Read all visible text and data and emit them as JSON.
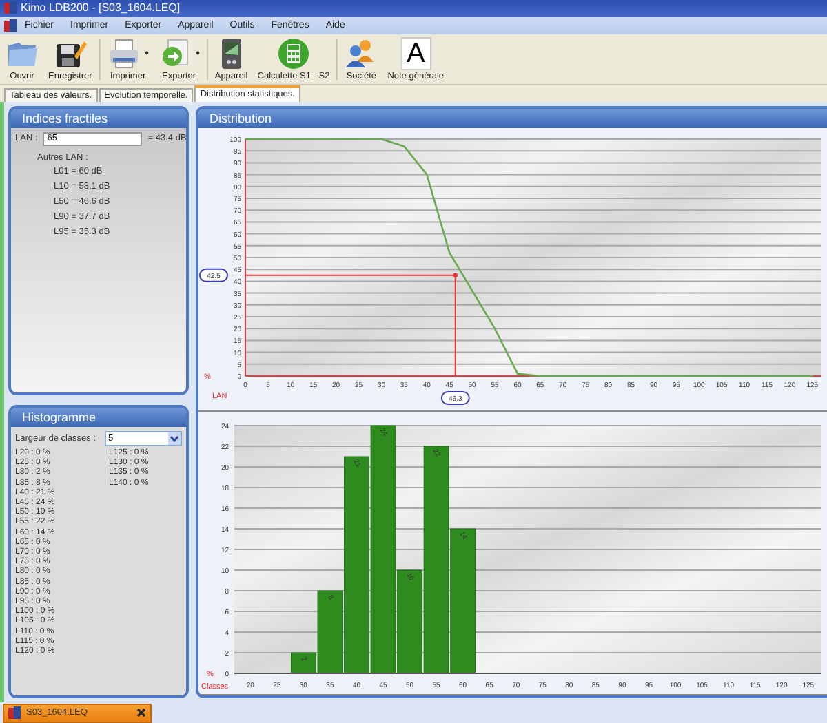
{
  "window": {
    "title": "Kimo LDB200 - [S03_1604.LEQ]"
  },
  "menu": [
    "Fichier",
    "Imprimer",
    "Exporter",
    "Appareil",
    "Outils",
    "Fenêtres",
    "Aide"
  ],
  "toolbar": [
    {
      "label": "Ouvrir",
      "dropdown": false
    },
    {
      "label": "Enregistrer",
      "dropdown": false
    },
    {
      "label": "Imprimer",
      "dropdown": true
    },
    {
      "label": "Exporter",
      "dropdown": true
    },
    {
      "label": "Appareil",
      "dropdown": false
    },
    {
      "label": "Calculette S1 - S2",
      "dropdown": false
    },
    {
      "label": "Société",
      "dropdown": false
    },
    {
      "label": "Note générale",
      "glyph": "A",
      "dropdown": false
    }
  ],
  "tabs": [
    {
      "label": "Tableau des valeurs.",
      "selected": false
    },
    {
      "label": "Evolution temporelle.",
      "selected": false
    },
    {
      "label": "Distribution statistiques.",
      "selected": true
    }
  ],
  "indices": {
    "title": "Indices fractiles",
    "lan_label": "LAN :",
    "lan_value": "65",
    "lan_result": "= 43.4 dB",
    "others_label": "Autres LAN :",
    "others": [
      "L01 = 60 dB",
      "L10 = 58.1 dB",
      "L50 = 46.6 dB",
      "L90 = 37.7 dB",
      "L95 = 35.3 dB"
    ]
  },
  "histogram_panel": {
    "title": "Histogramme",
    "width_label": "Largeur de classes :",
    "width_value": "5",
    "columns": [
      [
        "L20 : 0 %",
        "L25 : 0 %",
        "L30 : 2 %",
        "L35 : 8 %",
        "L40 : 21 %",
        "L45 : 24 %",
        "L50 : 10 %",
        "L55 : 22 %",
        "L60 : 14 %",
        "L65 : 0 %",
        "L70 : 0 %",
        "L75 : 0 %",
        "L80 : 0 %",
        "L85 : 0 %",
        "L90 : 0 %",
        "L95 : 0 %",
        "L100 : 0 %",
        "L105 : 0 %",
        "L110 : 0 %",
        "L115 : 0 %",
        "L120 : 0 %"
      ],
      [
        "L125 : 0 %",
        "L130 : 0 %",
        "L135 : 0 %",
        "L140 : 0 %"
      ]
    ]
  },
  "distribution": {
    "title": "Distribution",
    "cumulative": {
      "chart_data": {
        "type": "line",
        "xlabel": "LAN",
        "ylabel": "%",
        "x": [
          0,
          5,
          10,
          15,
          20,
          25,
          30,
          35,
          40,
          45,
          50,
          55,
          60,
          65,
          70,
          75,
          80,
          85,
          90,
          95,
          100,
          105,
          110,
          115,
          120,
          125
        ],
        "series": [
          {
            "color": "#6aa84f",
            "values": [
              100,
              100,
              100,
              100,
              100,
              100,
              100,
              97,
              85,
              52,
              36,
              20,
              1,
              0,
              0,
              0,
              0,
              0,
              0,
              0,
              0,
              0,
              0,
              0,
              0,
              0
            ]
          }
        ],
        "xlim": [
          0,
          127
        ],
        "ylim": [
          0,
          100
        ],
        "grid": true,
        "xticks": [
          0,
          5,
          10,
          15,
          20,
          25,
          30,
          35,
          40,
          45,
          50,
          55,
          60,
          65,
          70,
          75,
          80,
          85,
          90,
          95,
          100,
          105,
          110,
          115,
          120,
          125
        ],
        "yticks": [
          0,
          5,
          10,
          15,
          20,
          25,
          30,
          35,
          40,
          45,
          50,
          55,
          60,
          65,
          70,
          75,
          80,
          85,
          90,
          95,
          100
        ],
        "annotations": [
          "42.5",
          "46.3"
        ]
      }
    },
    "histogram": {
      "chart_data": {
        "type": "bar",
        "xlabel": "Classes",
        "ylabel": "%",
        "categories": [
          "20",
          "25",
          "30",
          "35",
          "40",
          "45",
          "50",
          "55",
          "60",
          "65",
          "70",
          "75",
          "80",
          "85",
          "90",
          "95",
          "100",
          "105",
          "110",
          "115",
          "120",
          "125"
        ],
        "series": [
          {
            "color": "#2e8b1e",
            "values": [
              0,
              0,
              2,
              8,
              21,
              24,
              10,
              22,
              14,
              0,
              0,
              0,
              0,
              0,
              0,
              0,
              0,
              0,
              0,
              0,
              0,
              0
            ]
          }
        ],
        "ylim": [
          0,
          24
        ],
        "grid": true,
        "yticks": [
          0,
          2,
          4,
          6,
          8,
          10,
          12,
          14,
          16,
          18,
          20,
          22,
          24
        ],
        "value_labels": [
          null,
          null,
          "2",
          "8",
          "21",
          "24",
          "10",
          "22",
          "14",
          null,
          null,
          null,
          null,
          null,
          null,
          null,
          null,
          null,
          null,
          null,
          null,
          null
        ]
      }
    }
  },
  "taskbar": [
    {
      "label": "S03_1604.LEQ"
    }
  ]
}
